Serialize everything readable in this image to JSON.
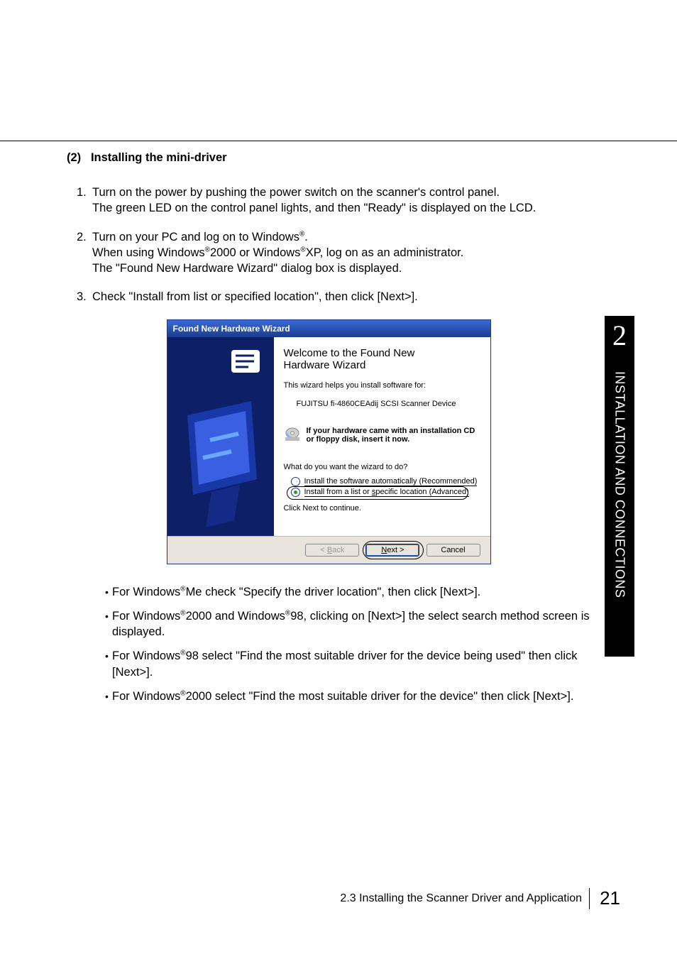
{
  "section": {
    "number": "(2)",
    "title": "Installing the mini-driver"
  },
  "steps": [
    {
      "n": "1.",
      "lines": [
        "Turn on the power by pushing the power switch on the scanner's control panel.",
        "The green LED on the control panel lights, and then \"Ready\" is displayed on the LCD."
      ]
    },
    {
      "n": "2.",
      "lines_html": "Turn on your PC and log on to Windows<sup>®</sup>.<br>When using Windows<sup>®</sup>2000 or Windows<sup>®</sup>XP, log on as an administrator.<br>The \"Found New Hardware Wizard\" dialog box is displayed."
    },
    {
      "n": "3.",
      "lines": [
        "Check \"Install from list or specified location\",  then click [Next>]."
      ]
    }
  ],
  "dialog": {
    "titlebar": "Found New Hardware Wizard",
    "welcome_l1": "Welcome to the Found New",
    "welcome_l2": "Hardware Wizard",
    "helps": "This wizard helps you install software for:",
    "device": "FUJITSU fi-4860CEAdij  SCSI Scanner Device",
    "cd_msg_l1": "If your hardware came with an installation CD",
    "cd_msg_l2": "or floppy disk, insert it now.",
    "question": "What do you want the wizard to do?",
    "opt1": "Install the software automatically (Recommended)",
    "opt2": "Install from a list or specific location (Advanced)",
    "continue": "Click Next to continue.",
    "back": "< Back",
    "next": "Next >",
    "cancel": "Cancel"
  },
  "bullets_html": [
    "For Windows<sup>®</sup>Me check \"Specify the driver location\", then click [Next>].",
    "For Windows<sup>®</sup>2000 and Windows<sup>®</sup>98, clicking on [Next>] the select search method screen is displayed.",
    "For Windows<sup>®</sup>98 select \"Find the most suitable driver for the device being used\" then click [Next>].",
    "For Windows<sup>®</sup>2000 select \"Find the most suitable driver for the device\" then click [Next>]."
  ],
  "tab": {
    "chapter": "2",
    "label": "INSTALLATION AND CONNECTIONS"
  },
  "footer": {
    "section_title": "2.3 Installing the Scanner Driver and Application",
    "page_num": "21"
  }
}
